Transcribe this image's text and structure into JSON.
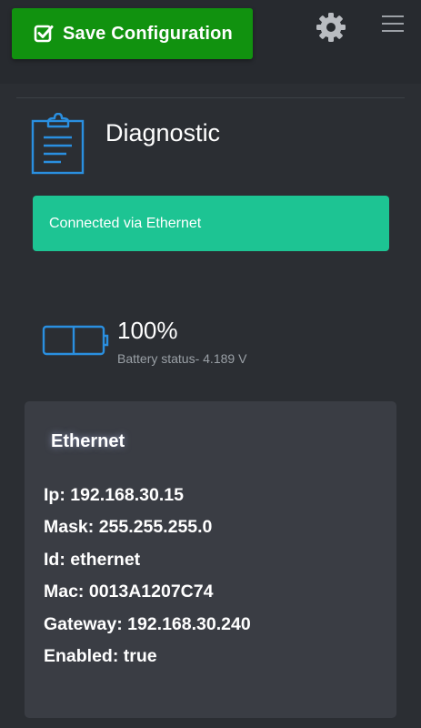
{
  "toolbar": {
    "save_label": "Save Configuration",
    "save_icon": "check-square-icon",
    "settings_icon": "gear-icon",
    "menu_icon": "hamburger-menu-icon"
  },
  "diagnostic": {
    "title": "Diagnostic",
    "icon": "clipboard-icon"
  },
  "connection": {
    "status": "Connected via Ethernet",
    "color": "#1dc493"
  },
  "battery": {
    "percent": "100%",
    "status": "Battery status- 4.189 V",
    "icon": "battery-icon"
  },
  "ethernet": {
    "title": "Ethernet",
    "rows": [
      "Ip: 192.168.30.15",
      "Mask: 255.255.255.0",
      "Id: ethernet",
      "Mac: 0013A1207C74",
      "Gateway: 192.168.30.240",
      "Enabled: true"
    ]
  },
  "colors": {
    "save_button": "#11920f",
    "accent_blue": "#2a8fe0",
    "background": "#2b2e33"
  }
}
